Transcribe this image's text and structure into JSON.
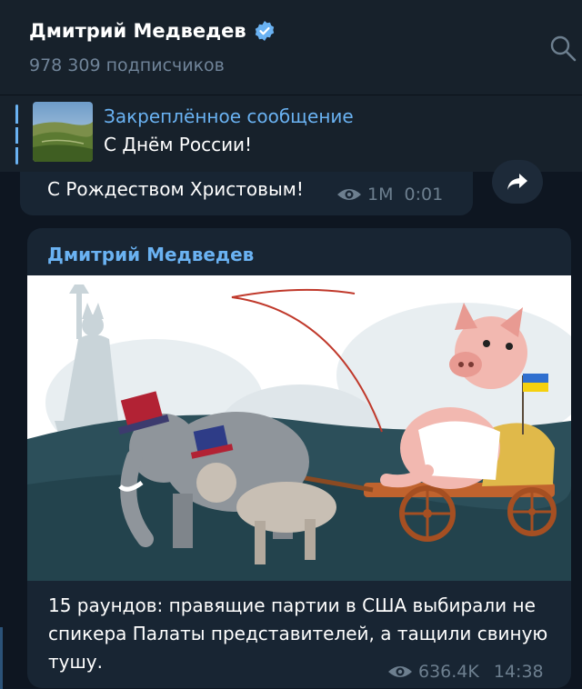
{
  "header": {
    "channel_name": "Дмитрий Медведев",
    "verified_icon": "verified-check-icon",
    "subscribers": "978 309 подписчиков",
    "search_icon": "search-icon"
  },
  "pinned": {
    "title": "Закреплённое сообщение",
    "text": "С Днём России!",
    "thumbnail": "landscape-thumbnail"
  },
  "previous_message": {
    "text": "С Рождеством Христовым!",
    "views": "1M",
    "time": "0:01",
    "share_icon": "share-arrow-icon"
  },
  "post": {
    "author": "Дмитрий Медведев",
    "text": "15 раундов: правящие партии в США выбирали не спикера Палаты представителей, а тащили свиную тушу.",
    "views": "636.4K",
    "time": "14:38",
    "image": "cartoon-pig-cart-elephant-donkey"
  },
  "colors": {
    "background": "#0e1621",
    "header": "#17212b",
    "bubble": "#182533",
    "accent": "#6ab2f2",
    "meta": "#6d7f8f"
  }
}
